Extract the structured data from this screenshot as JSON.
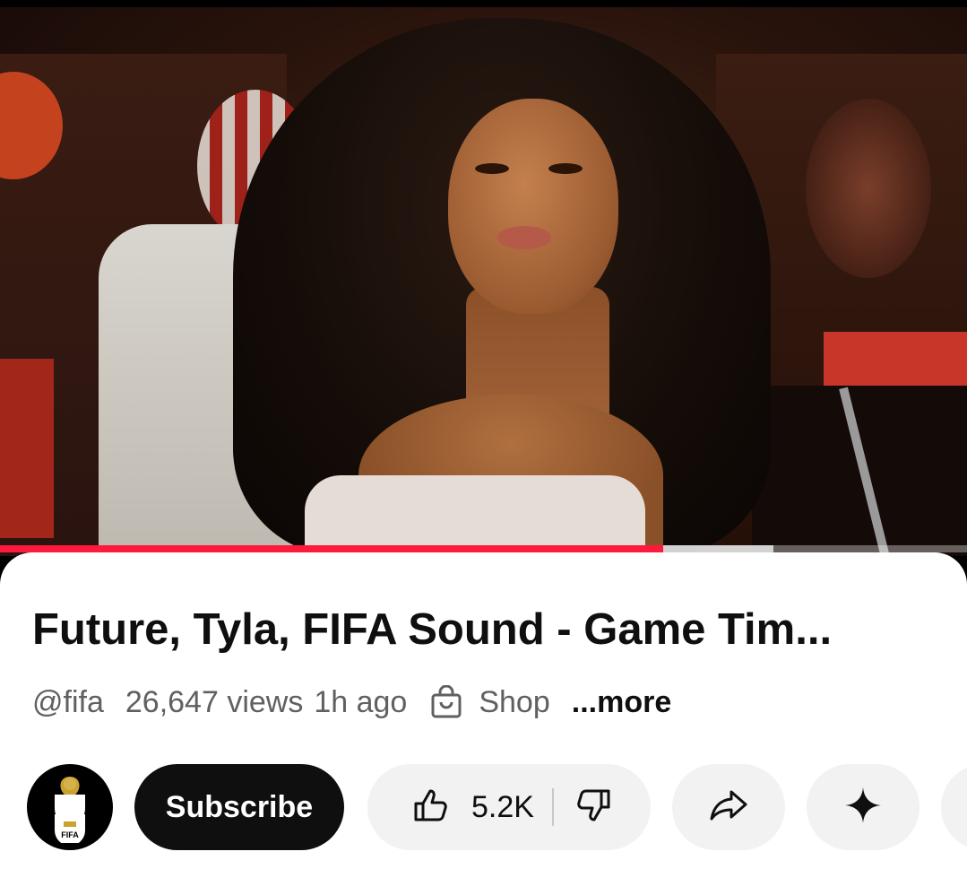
{
  "video": {
    "progress_played": 0.686,
    "progress_buffered": 0.8
  },
  "info": {
    "title": "Future, Tyla, FIFA Sound - Game Tim...",
    "channel_handle": "@fifa",
    "views": "26,647 views",
    "age": "1h ago",
    "shop_label": "Shop",
    "more_label": "...more"
  },
  "actions": {
    "avatar_text": "FIFA",
    "subscribe_label": "Subscribe",
    "like_count": "5.2K"
  },
  "icons": {
    "shop": "shopping-bag-icon",
    "like": "thumbs-up-icon",
    "dislike": "thumbs-down-icon",
    "share": "share-arrow-icon",
    "ask": "sparkle-icon"
  },
  "colors": {
    "progress": "#ff1a3d",
    "panel_bg": "#ffffff",
    "pill_bg": "#f2f2f2",
    "subscribe_bg": "#0f0f0f",
    "text_primary": "#0f0f0f",
    "text_secondary": "#606060"
  }
}
